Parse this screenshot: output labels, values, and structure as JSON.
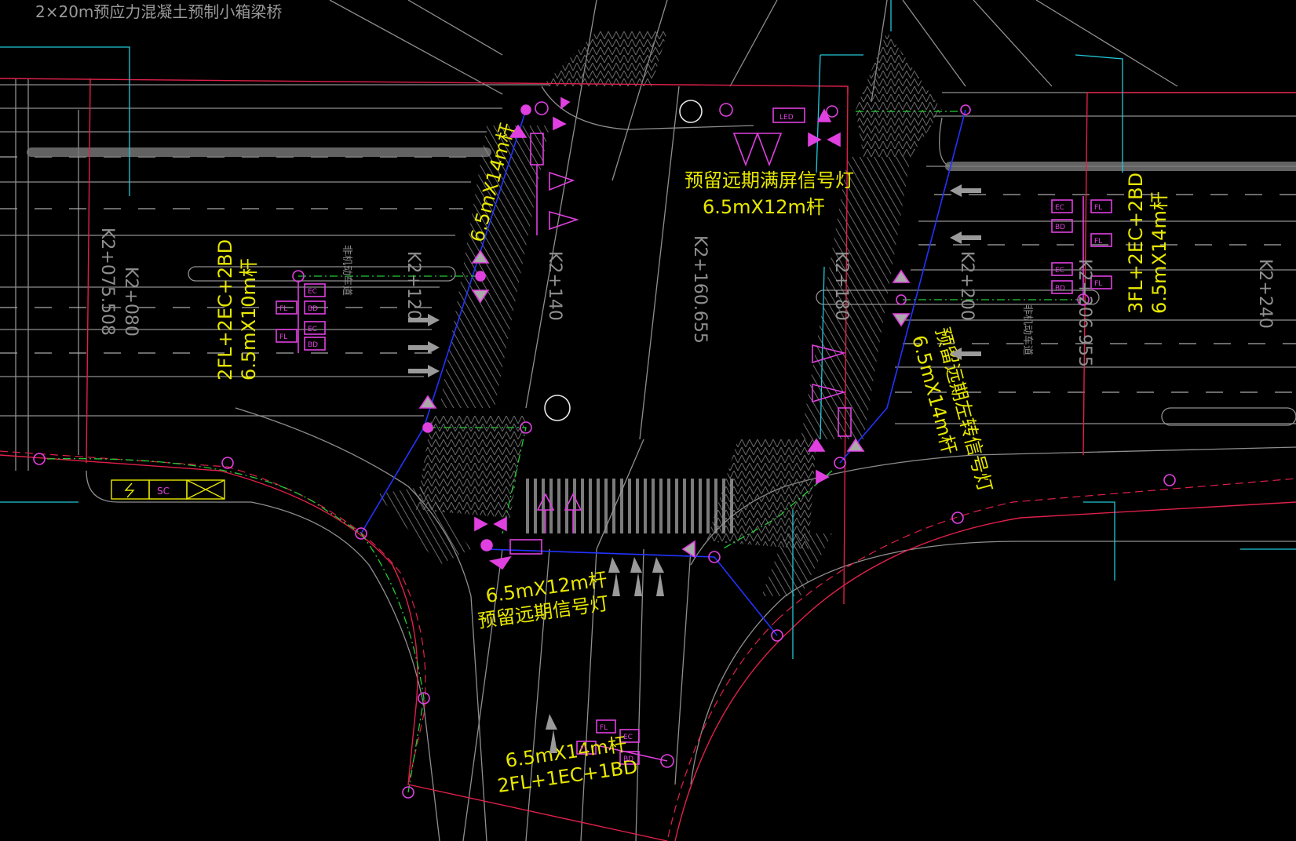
{
  "title": "2×20m预应力混凝土预制小箱梁桥",
  "colors": {
    "background": "#000000",
    "road_line": "#8f8f8f",
    "boundary": "#e0204a",
    "cyan": "#22c8d8",
    "signal": "#e040e0",
    "annotation": "#e8e800",
    "cable": "#2233ff",
    "green": "#22cc33",
    "hatch": "#6a6a6a"
  },
  "annotations": {
    "top_center_1": "预留远期满屏信号灯",
    "top_center_2": "6.5mX12m杆",
    "pole_north_arm": "6.5mX14m杆",
    "pole_west_1": "2FL+2EC+2BD",
    "pole_west_2": "6.5mX10m杆",
    "pole_east_1": "3FL+2EC+2BD",
    "pole_east_2": "6.5mX14m杆",
    "east_reserve_1": "预留远期左转信号灯",
    "east_reserve_2": "6.5mX14m杆",
    "south_reserve_1": "6.5mX12m杆",
    "south_reserve_2": "预留远期信号灯",
    "south_pole_1": "6.5mX14m杆",
    "south_pole_2": "2FL+1EC+1BD"
  },
  "stations": {
    "s1": "K2+075.508",
    "s2": "K2+080",
    "s3": "K2+120",
    "s4": "K2+140",
    "s5": "K2+160.655",
    "s6": "K2+180",
    "s7": "K2+200",
    "s8": "K2+206.955",
    "s9": "K2+240"
  },
  "device_labels": {
    "led": "LED",
    "ec": "EC",
    "bd": "BD",
    "fl": "FL",
    "cabinet_sc": "SC"
  },
  "road_markings": {
    "nonmotor": "非机动车道"
  }
}
